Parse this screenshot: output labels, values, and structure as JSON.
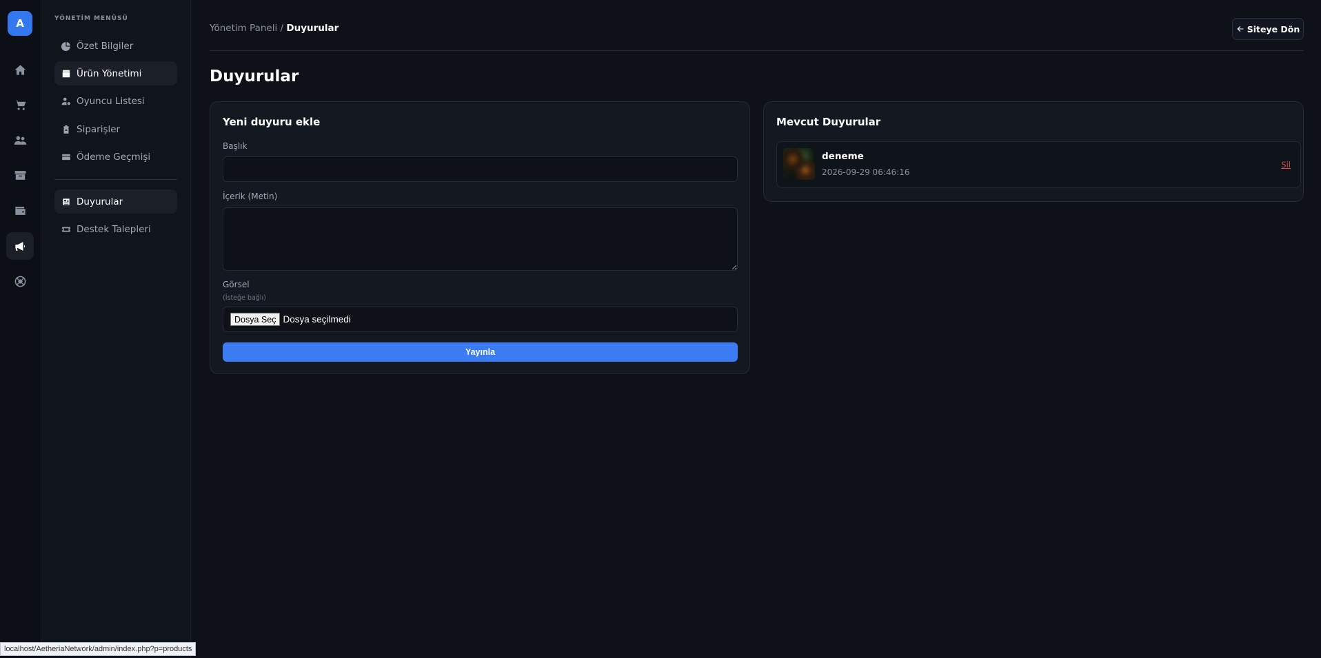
{
  "rail": {
    "logo": "A",
    "icons": [
      "home-icon",
      "cart-icon",
      "users-icon",
      "archive-icon",
      "wallet-icon",
      "megaphone-icon",
      "lifebuoy-icon"
    ]
  },
  "sidebar": {
    "menu_title": "YÖNETİM MENÜSÜ",
    "items": [
      {
        "label": "Özet Bilgiler",
        "icon": "pie-chart-icon"
      },
      {
        "label": "Ürün Yönetimi",
        "icon": "box-icon"
      },
      {
        "label": "Oyuncu Listesi",
        "icon": "user-gear-icon"
      },
      {
        "label": "Siparişler",
        "icon": "clipboard-icon"
      },
      {
        "label": "Ödeme Geçmişi",
        "icon": "credit-card-icon"
      },
      {
        "label": "Duyurular",
        "icon": "newspaper-icon"
      },
      {
        "label": "Destek Talepleri",
        "icon": "ticket-icon"
      }
    ]
  },
  "header": {
    "breadcrumb_root": "Yönetim Paneli",
    "breadcrumb_sep": " / ",
    "breadcrumb_current": "Duyurular",
    "back_button": "Siteye Dön"
  },
  "page": {
    "title": "Duyurular"
  },
  "form": {
    "title": "Yeni duyuru ekle",
    "title_label": "Başlık",
    "title_value": "",
    "content_label": "İçerik (Metin)",
    "content_value": "",
    "image_label": "Görsel",
    "image_hint": "(İsteğe bağlı)",
    "file_button": "Dosya Seç",
    "file_status": "Dosya seçilmedi",
    "submit": "Yayınla"
  },
  "announcements": {
    "title": "Mevcut Duyurular",
    "items": [
      {
        "title": "deneme",
        "date": "2026-09-29 06:46:16",
        "delete": "Sil"
      }
    ]
  },
  "status_bar": {
    "url": "localhost/AetheriaNetwork/admin/index.php?p=products"
  },
  "colors": {
    "accent": "#3b7cf4",
    "danger": "#e04848",
    "background": "#0e1118",
    "card": "#141821"
  }
}
